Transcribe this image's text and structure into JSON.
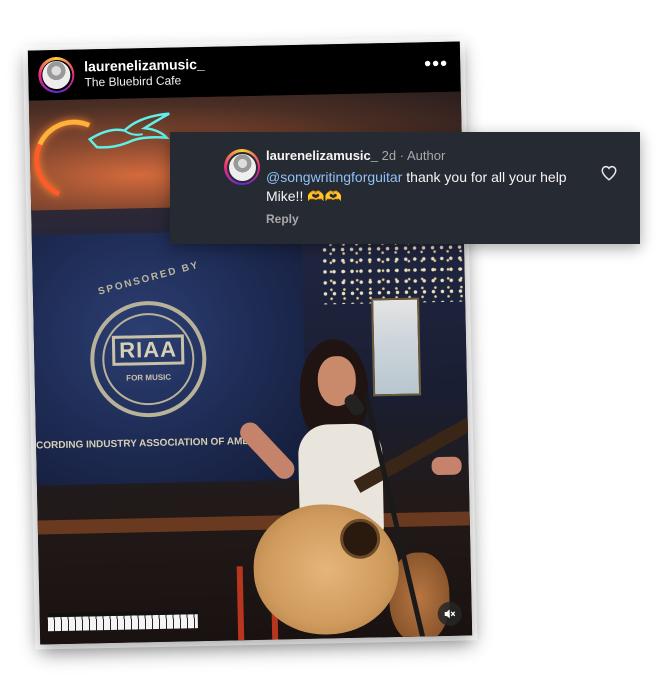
{
  "post": {
    "username": "laurenelizamusic_",
    "location": "The Bluebird Cafe",
    "more_label": "•••",
    "photo": {
      "banner_sponsored": "SPONSORED BY",
      "banner_logo": "RIAA",
      "banner_logo_sub": "FOR MUSIC",
      "banner_assoc": "CORDING INDUSTRY ASSOCIATION OF AME"
    },
    "mute_icon": "speaker-muted-icon"
  },
  "comment": {
    "username": "laurenelizamusic_",
    "time": "2d",
    "separator": "·",
    "badge": "Author",
    "mention": "@songwritingforguitar",
    "text": " thank you for all your help Mike!! 🫶🫶",
    "reply_label": "Reply",
    "like_icon": "heart-outline-icon"
  },
  "colors": {
    "comment_bg": "#262a33",
    "mention": "#8fc1f7",
    "secondary_text": "#a8a8a8"
  }
}
